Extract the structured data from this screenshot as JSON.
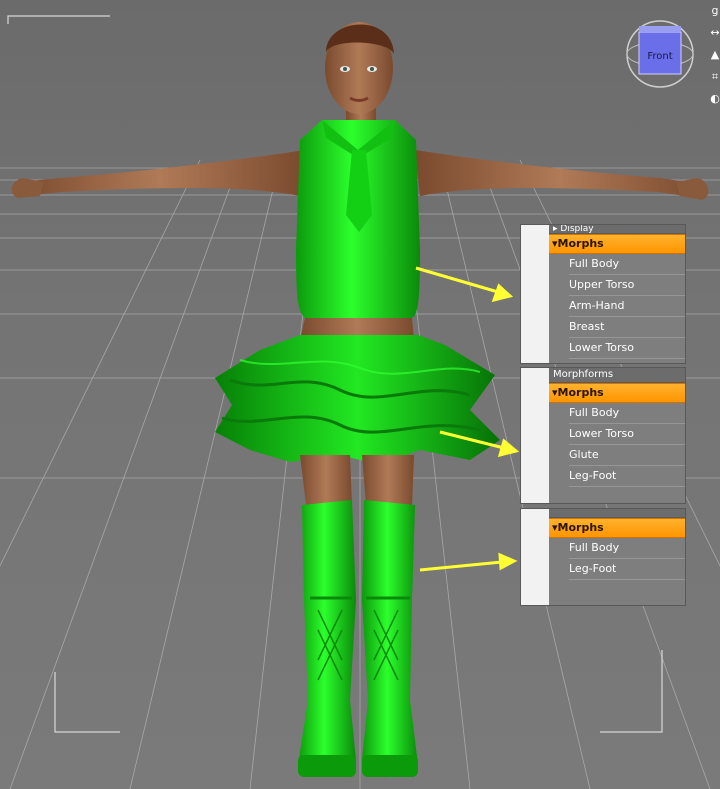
{
  "viewport": {
    "camera_label": "Front",
    "colors": {
      "background": "#707070",
      "grid": "#b5b5b5",
      "outfit": "#19e619",
      "arrow": "#ffff33"
    }
  },
  "right_toolbar_glyphs": [
    "g",
    "↔",
    "▲",
    "⌗",
    "◐"
  ],
  "panels": [
    {
      "section_title": "Display",
      "header_label": "Morphs",
      "items": [
        "Full Body",
        "Upper Torso",
        "Arm-Hand",
        "Breast",
        "Lower Torso"
      ]
    },
    {
      "section_title": "Morphforms",
      "header_label": "Morphs",
      "items": [
        "Full Body",
        "Lower Torso",
        "Glute",
        "Leg-Foot"
      ]
    },
    {
      "section_title": "",
      "header_label": "Morphs",
      "items": [
        "Full Body",
        "Leg-Foot"
      ]
    }
  ],
  "colors": {
    "header_orange": "#ff9f1a",
    "panel_bg": "#7e7e7e",
    "gutter": "#f2f2f2"
  }
}
